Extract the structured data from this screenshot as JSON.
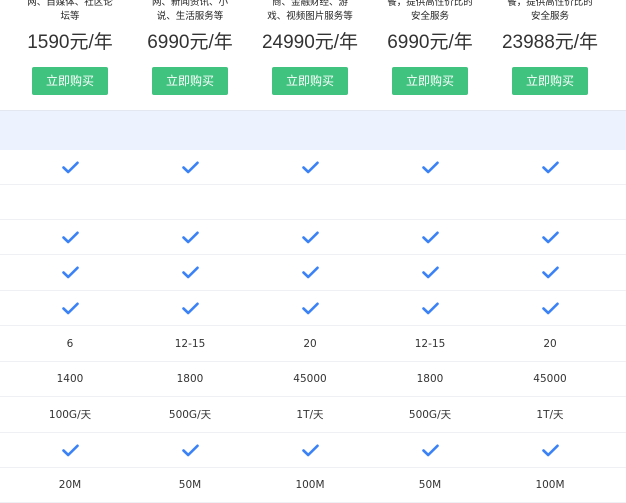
{
  "plans": [
    {
      "desc_line1": "网、自媒体、社区论",
      "desc_line2": "坛等",
      "price": "1590元/年",
      "button": "立即购买"
    },
    {
      "desc_line1": "网、新闻资讯、小",
      "desc_line2": "说、生活服务等",
      "price": "6990元/年",
      "button": "立即购买"
    },
    {
      "desc_line1": "商、金融财经、游",
      "desc_line2": "戏、视频图片服务等",
      "price": "24990元/年",
      "button": "立即购买"
    },
    {
      "desc_line1": "餐，提供高性价比的",
      "desc_line2": "安全服务",
      "price": "6990元/年",
      "button": "立即购买"
    },
    {
      "desc_line1": "餐，提供高性价比的",
      "desc_line2": "安全服务",
      "price": "23988元/年",
      "button": "立即购买"
    }
  ],
  "rows": [
    {
      "type": "check",
      "cells": [
        true,
        true,
        true,
        true,
        true
      ]
    },
    {
      "type": "empty",
      "cells": [
        "",
        "",
        "",
        "",
        ""
      ]
    },
    {
      "type": "check",
      "cells": [
        true,
        true,
        true,
        true,
        true
      ]
    },
    {
      "type": "check",
      "cells": [
        true,
        true,
        true,
        true,
        true
      ]
    },
    {
      "type": "check",
      "cells": [
        true,
        true,
        true,
        true,
        true
      ]
    },
    {
      "type": "text",
      "cells": [
        "6",
        "12-15",
        "20",
        "12-15",
        "20"
      ]
    },
    {
      "type": "text",
      "cells": [
        "1400",
        "1800",
        "45000",
        "1800",
        "45000"
      ]
    },
    {
      "type": "text",
      "cells": [
        "100G/天",
        "500G/天",
        "1T/天",
        "500G/天",
        "1T/天"
      ]
    },
    {
      "type": "check",
      "cells": [
        true,
        true,
        true,
        true,
        true
      ]
    },
    {
      "type": "text",
      "cells": [
        "20M",
        "50M",
        "100M",
        "50M",
        "100M"
      ]
    }
  ],
  "colors": {
    "button": "#3fc37e",
    "check": "#3b82f6",
    "band": "#ecf3fe"
  },
  "icons": {
    "check": "check-icon"
  }
}
